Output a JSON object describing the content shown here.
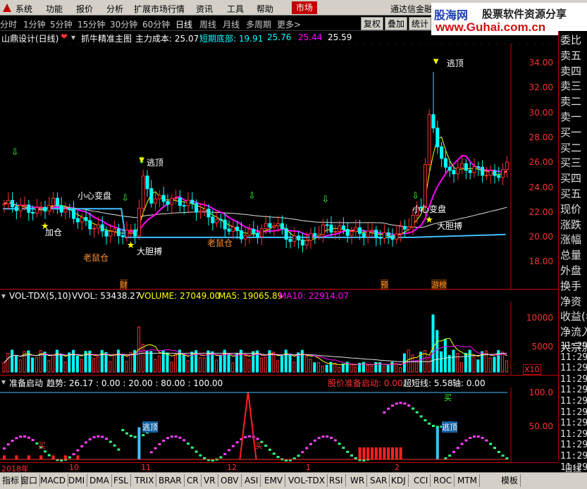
{
  "menu": {
    "items": [
      "系统",
      "功能",
      "报价",
      "分析",
      "扩展市场行情",
      "资讯",
      "工具",
      "帮助"
    ],
    "active": "市场",
    "broker": "通达信金融"
  },
  "watermark": {
    "site": "股海网",
    "tagline": "股票软件资源分享",
    "url": "www.Guhai.com.cn"
  },
  "periods": [
    "分时",
    "1分钟",
    "5分钟",
    "15分钟",
    "30分钟",
    "60分钟",
    "日线",
    "周线",
    "月线",
    "多周期",
    "更多>"
  ],
  "selected_period": "日线",
  "right_buttons": [
    "复权",
    "叠加",
    "统计"
  ],
  "main_chart": {
    "stock": "山鼎设计(日线)",
    "indicator": "抓牛精准主图",
    "cost_label": "主力成本: 25.07",
    "bottom_label": "短期底部: 19.91",
    "v1": "25.76",
    "v2": "25.44",
    "v3": "25.59",
    "y_ticks": [
      "34.00",
      "32.00",
      "30.00",
      "28.00",
      "26.00",
      "24.00",
      "22.00",
      "20.00",
      "18.00"
    ],
    "annotations": {
      "escape1": "逃顶",
      "escape2": "逃顶",
      "careful": "小心变盘",
      "add": "加仓",
      "bold1": "大胆搏",
      "bold2": "大胆搏",
      "rat1": "老鼠仓",
      "rat2": "老鼠仓",
      "careful2": "小心变盘",
      "mark_cai": "财",
      "mark_yu": "预",
      "mark_jiabang": "游榜"
    }
  },
  "vol_chart": {
    "name": "VOL-TDX(5,10)",
    "vvol": "VVOL: 53438.27",
    "volume": "VOLUME: 27049.00",
    "ma5": "MA5: 19065.89",
    "ma10": "MA10: 22914.07",
    "y_ticks": [
      "10000",
      "5000"
    ],
    "unit": "X10"
  },
  "ind_chart": {
    "name": "准备启动",
    "trend": "趋势: 26.17 : 0.00 : 20.00 : 80.00 : 100.00",
    "price_ready": "股价准备启动: 0.00",
    "super_short": "超短线: 5.58",
    "axis": "轴: 0.00",
    "y_ticks": [
      "100.0",
      "50.00"
    ],
    "labels": {
      "buy1": "买",
      "buy2": "买",
      "escape1": "逃顶",
      "escape2": "逃顶",
      "buy3": "买"
    }
  },
  "date_axis": [
    "2018年",
    "10",
    "11",
    "12",
    "1",
    "2"
  ],
  "date_axis_right": "日线",
  "side": {
    "quote_items": [
      "委比",
      "卖五",
      "卖四",
      "卖三",
      "卖二",
      "卖一",
      "买一",
      "买二",
      "买三",
      "买四",
      "买五",
      "现价",
      "涨跌",
      "涨幅",
      "总量",
      "外盘",
      "换手",
      "净资",
      "收益(年",
      "净流入",
      "大宗流"
    ],
    "times": [
      "11:29",
      "11:29",
      "11:29",
      "11:29",
      "11:29",
      "11:29",
      "11:29",
      "11:29",
      "11:29",
      "11:29",
      "11:29",
      "11:29",
      "11:29",
      "11:29"
    ]
  },
  "tabs": [
    "指标",
    "窗口",
    "MACD",
    "DMI",
    "DMA",
    "FSL",
    "TRIX",
    "BRAR",
    "CR",
    "VR",
    "OBV",
    "ASI",
    "EMV",
    "VOL-TDX",
    "RSI",
    "WR",
    "SAR",
    "KDJ",
    "CCI",
    "ROC",
    "MTM",
    "模板"
  ],
  "colors": {
    "up": "#ff3030",
    "down": "#00ffff",
    "ma_yellow": "#ffff00",
    "ma_mag": "#ff00ff",
    "frame": "#c00000"
  }
}
